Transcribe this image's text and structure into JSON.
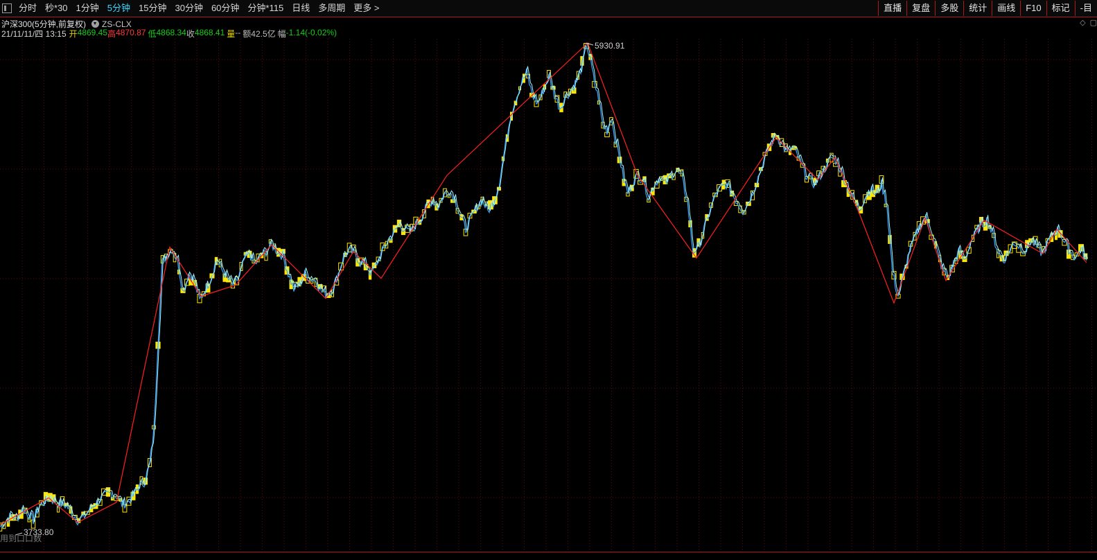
{
  "toolbar": {
    "periods": [
      "分时",
      "秒*30",
      "1分钟",
      "5分钟",
      "15分钟",
      "30分钟",
      "60分钟",
      "分钟*115",
      "日线",
      "多周期",
      "更多"
    ],
    "active": "5分钟",
    "more_arrow": ">",
    "right_buttons": [
      "直播",
      "复盘",
      "多股",
      "统计",
      "画线",
      "F10",
      "标记",
      "-目"
    ]
  },
  "info": {
    "title": "沪深300(5分钟,前复权)",
    "indicator": "ZS-CLX",
    "datetime": "21/11/11/四 13:15",
    "open_label": "开",
    "open": "4869.45",
    "high_label": "高",
    "high": "4870.87",
    "low_label": "低",
    "low": "4868.34",
    "close_label": "收",
    "close": "4868.41",
    "volume_label": "量",
    "volume": "--",
    "amount_label": "额",
    "amount": "42.5亿",
    "change_label": "幅",
    "change": "-1.14(-0.02%)"
  },
  "corner": {
    "diamond": "◇",
    "square": "▢"
  },
  "chart_data": {
    "type": "line",
    "annotations": [
      {
        "text": "5930.91",
        "kind": "high",
        "x": 5930.91
      },
      {
        "text": "3733.80",
        "kind": "low",
        "x": 3733.8
      }
    ],
    "ylim": [
      3700,
      6000
    ],
    "zigzag": [
      [
        0,
        3780
      ],
      [
        70,
        3900
      ],
      [
        112,
        3790
      ],
      [
        168,
        3880
      ],
      [
        245,
        5020
      ],
      [
        290,
        4800
      ],
      [
        340,
        4850
      ],
      [
        392,
        5030
      ],
      [
        470,
        4790
      ],
      [
        510,
        5000
      ],
      [
        550,
        4880
      ],
      [
        645,
        5340
      ],
      [
        848,
        5931
      ],
      [
        920,
        5340
      ],
      [
        1005,
        4970
      ],
      [
        1120,
        5510
      ],
      [
        1180,
        5320
      ],
      [
        1205,
        5420
      ],
      [
        1240,
        5170
      ],
      [
        1290,
        4770
      ],
      [
        1335,
        5150
      ],
      [
        1365,
        4870
      ],
      [
        1420,
        5140
      ],
      [
        1505,
        4990
      ],
      [
        1525,
        5100
      ],
      [
        1568,
        4950
      ]
    ],
    "series": [
      {
        "values": [
          [
            0,
            3770
          ],
          [
            8,
            3795
          ],
          [
            16,
            3820
          ],
          [
            24,
            3805
          ],
          [
            32,
            3850
          ],
          [
            40,
            3830
          ],
          [
            48,
            3800
          ],
          [
            56,
            3860
          ],
          [
            64,
            3880
          ],
          [
            72,
            3900
          ],
          [
            80,
            3880
          ],
          [
            88,
            3870
          ],
          [
            96,
            3865
          ],
          [
            104,
            3830
          ],
          [
            112,
            3800
          ],
          [
            120,
            3810
          ],
          [
            128,
            3840
          ],
          [
            136,
            3870
          ],
          [
            144,
            3890
          ],
          [
            152,
            3910
          ],
          [
            160,
            3920
          ],
          [
            168,
            3910
          ],
          [
            176,
            3870
          ],
          [
            184,
            3880
          ],
          [
            192,
            3910
          ],
          [
            200,
            3950
          ],
          [
            208,
            3970
          ],
          [
            216,
            4050
          ],
          [
            222,
            4200
          ],
          [
            228,
            4600
          ],
          [
            234,
            4950
          ],
          [
            240,
            4980
          ],
          [
            248,
            5010
          ],
          [
            256,
            4960
          ],
          [
            264,
            4820
          ],
          [
            272,
            4900
          ],
          [
            280,
            4870
          ],
          [
            288,
            4780
          ],
          [
            296,
            4830
          ],
          [
            304,
            4880
          ],
          [
            312,
            4960
          ],
          [
            320,
            4920
          ],
          [
            328,
            4880
          ],
          [
            336,
            4850
          ],
          [
            344,
            4880
          ],
          [
            352,
            4960
          ],
          [
            360,
            4990
          ],
          [
            368,
            4940
          ],
          [
            376,
            4980
          ],
          [
            384,
            5000
          ],
          [
            392,
            5030
          ],
          [
            400,
            5000
          ],
          [
            408,
            4980
          ],
          [
            416,
            4900
          ],
          [
            424,
            4830
          ],
          [
            432,
            4850
          ],
          [
            440,
            4900
          ],
          [
            448,
            4880
          ],
          [
            456,
            4870
          ],
          [
            464,
            4820
          ],
          [
            472,
            4810
          ],
          [
            480,
            4830
          ],
          [
            488,
            4900
          ],
          [
            496,
            4980
          ],
          [
            504,
            5000
          ],
          [
            512,
            4990
          ],
          [
            520,
            4950
          ],
          [
            528,
            4940
          ],
          [
            536,
            4900
          ],
          [
            544,
            4950
          ],
          [
            552,
            5000
          ],
          [
            560,
            5050
          ],
          [
            568,
            5080
          ],
          [
            576,
            5120
          ],
          [
            584,
            5100
          ],
          [
            592,
            5080
          ],
          [
            600,
            5120
          ],
          [
            608,
            5150
          ],
          [
            616,
            5200
          ],
          [
            624,
            5230
          ],
          [
            632,
            5200
          ],
          [
            640,
            5250
          ],
          [
            648,
            5270
          ],
          [
            656,
            5240
          ],
          [
            664,
            5160
          ],
          [
            672,
            5100
          ],
          [
            680,
            5150
          ],
          [
            688,
            5200
          ],
          [
            696,
            5230
          ],
          [
            704,
            5180
          ],
          [
            712,
            5220
          ],
          [
            720,
            5300
          ],
          [
            728,
            5450
          ],
          [
            736,
            5600
          ],
          [
            744,
            5680
          ],
          [
            752,
            5750
          ],
          [
            760,
            5800
          ],
          [
            768,
            5700
          ],
          [
            776,
            5660
          ],
          [
            784,
            5720
          ],
          [
            792,
            5780
          ],
          [
            800,
            5700
          ],
          [
            808,
            5640
          ],
          [
            816,
            5690
          ],
          [
            824,
            5720
          ],
          [
            832,
            5760
          ],
          [
            840,
            5830
          ],
          [
            846,
            5930
          ],
          [
            852,
            5850
          ],
          [
            858,
            5750
          ],
          [
            864,
            5680
          ],
          [
            870,
            5560
          ],
          [
            876,
            5540
          ],
          [
            882,
            5600
          ],
          [
            888,
            5500
          ],
          [
            894,
            5420
          ],
          [
            900,
            5320
          ],
          [
            906,
            5260
          ],
          [
            912,
            5300
          ],
          [
            920,
            5340
          ],
          [
            928,
            5320
          ],
          [
            936,
            5240
          ],
          [
            944,
            5300
          ],
          [
            952,
            5330
          ],
          [
            960,
            5300
          ],
          [
            968,
            5340
          ],
          [
            976,
            5360
          ],
          [
            984,
            5330
          ],
          [
            992,
            5220
          ],
          [
            1000,
            5000
          ],
          [
            1008,
            5020
          ],
          [
            1016,
            5100
          ],
          [
            1024,
            5180
          ],
          [
            1032,
            5250
          ],
          [
            1040,
            5280
          ],
          [
            1048,
            5300
          ],
          [
            1056,
            5260
          ],
          [
            1064,
            5220
          ],
          [
            1072,
            5180
          ],
          [
            1080,
            5220
          ],
          [
            1088,
            5280
          ],
          [
            1096,
            5350
          ],
          [
            1104,
            5420
          ],
          [
            1112,
            5480
          ],
          [
            1120,
            5520
          ],
          [
            1128,
            5480
          ],
          [
            1136,
            5440
          ],
          [
            1144,
            5460
          ],
          [
            1152,
            5420
          ],
          [
            1160,
            5360
          ],
          [
            1168,
            5320
          ],
          [
            1176,
            5300
          ],
          [
            1184,
            5340
          ],
          [
            1192,
            5380
          ],
          [
            1200,
            5420
          ],
          [
            1208,
            5400
          ],
          [
            1216,
            5340
          ],
          [
            1224,
            5280
          ],
          [
            1232,
            5220
          ],
          [
            1240,
            5190
          ],
          [
            1248,
            5240
          ],
          [
            1256,
            5280
          ],
          [
            1264,
            5250
          ],
          [
            1272,
            5300
          ],
          [
            1280,
            5200
          ],
          [
            1288,
            4900
          ],
          [
            1296,
            4800
          ],
          [
            1304,
            4900
          ],
          [
            1312,
            5000
          ],
          [
            1320,
            5060
          ],
          [
            1328,
            5120
          ],
          [
            1336,
            5150
          ],
          [
            1344,
            5080
          ],
          [
            1352,
            5000
          ],
          [
            1360,
            4920
          ],
          [
            1368,
            4880
          ],
          [
            1376,
            4950
          ],
          [
            1384,
            5000
          ],
          [
            1392,
            4960
          ],
          [
            1400,
            5040
          ],
          [
            1408,
            5080
          ],
          [
            1416,
            5120
          ],
          [
            1424,
            5140
          ],
          [
            1432,
            5080
          ],
          [
            1440,
            5000
          ],
          [
            1448,
            4960
          ],
          [
            1456,
            5000
          ],
          [
            1464,
            5040
          ],
          [
            1472,
            5020
          ],
          [
            1480,
            5000
          ],
          [
            1488,
            5050
          ],
          [
            1496,
            5020
          ],
          [
            1504,
            4990
          ],
          [
            1512,
            5040
          ],
          [
            1520,
            5080
          ],
          [
            1528,
            5100
          ],
          [
            1536,
            5040
          ],
          [
            1544,
            5000
          ],
          [
            1552,
            4970
          ],
          [
            1560,
            5010
          ],
          [
            1568,
            4960
          ]
        ]
      }
    ]
  }
}
